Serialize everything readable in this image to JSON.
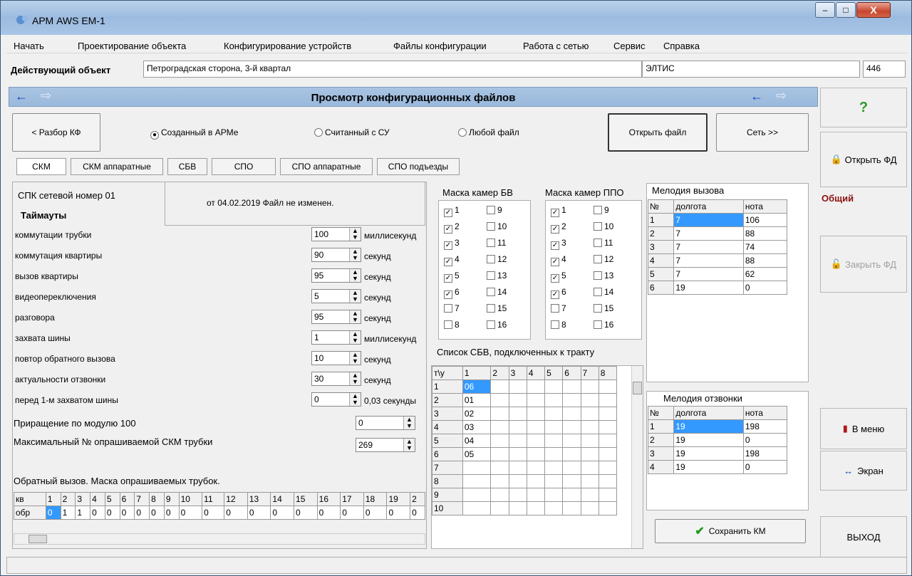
{
  "window": {
    "title": "АРМ AWS EM-1",
    "min": "–",
    "max": "□",
    "close": "X"
  },
  "menu": [
    "Начать",
    "Проектирование объекта",
    "Конфигурирование устройств",
    "Файлы конфигурации",
    "Работа с сетью",
    "Сервис",
    "Справка"
  ],
  "object": {
    "label": "Действующий объект",
    "name": "Петроградская сторона, 3-й квартал",
    "org": "ЭЛТИС",
    "code": "446"
  },
  "header": {
    "title": "Просмотр конфигурационных файлов",
    "back": "←",
    "fwd": "⇨"
  },
  "toolbar": {
    "parse": "< Разбор КФ",
    "radio": [
      "Созданный в АРМе",
      "Считанный с СУ",
      "Любой файл"
    ],
    "open": "Открыть файл",
    "net": "Сеть >>"
  },
  "tabs": [
    "СКМ",
    "СКМ аппаратные",
    "СБВ",
    "СПО",
    "СПО аппаратные",
    "СПО подъезды"
  ],
  "spk": {
    "label": "СПК сетевой номер  01",
    "date": "от 04.02.2019  Файл не изменен.",
    "timeouts": "Таймауты"
  },
  "timeouts": [
    {
      "name": "коммутации трубки",
      "value": "100",
      "unit": "миллисекунд"
    },
    {
      "name": "коммутация квартиры",
      "value": "90",
      "unit": "секунд"
    },
    {
      "name": "вызов квартиры",
      "value": "95",
      "unit": "секунд"
    },
    {
      "name": "видеопереключения",
      "value": "5",
      "unit": "секунд"
    },
    {
      "name": "разговора",
      "value": "95",
      "unit": "секунд"
    },
    {
      "name": "захвата шины",
      "value": "1",
      "unit": "миллисекунд"
    },
    {
      "name": "повтор обратного вызова",
      "value": "10",
      "unit": "секунд"
    },
    {
      "name": "актуальности отзвонки",
      "value": "30",
      "unit": "секунд"
    },
    {
      "name": "перед 1-м захватом шины",
      "value": "0",
      "unit": "0,03 секунды"
    }
  ],
  "increment": {
    "label": "Приращение по  модулю 100",
    "value": "0"
  },
  "maxskm": {
    "label": "Максимальный № опрашиваемой СКМ трубки",
    "value": "269"
  },
  "callback": {
    "label": "Обратный вызов. Маска опрашиваемых трубок.",
    "row1": "кв",
    "row2": "обр",
    "cols": [
      "1",
      "2",
      "3",
      "4",
      "5",
      "6",
      "7",
      "8",
      "9",
      "10",
      "11",
      "12",
      "13",
      "14",
      "15",
      "16",
      "17",
      "18",
      "19",
      "2"
    ],
    "vals": [
      "0",
      "1",
      "1",
      "0",
      "0",
      "0",
      "0",
      "0",
      "0",
      "0",
      "0",
      "0",
      "0",
      "0",
      "0",
      "0",
      "0",
      "0",
      "0",
      "0"
    ]
  },
  "maskBV": {
    "title": "Маска камер БВ",
    "items": [
      [
        "1",
        "9"
      ],
      [
        "2",
        "10"
      ],
      [
        "3",
        "11"
      ],
      [
        "4",
        "12"
      ],
      [
        "5",
        "13"
      ],
      [
        "6",
        "14"
      ],
      [
        "7",
        "15"
      ],
      [
        "8",
        "16"
      ]
    ],
    "checked": [
      1,
      1,
      1,
      1,
      1,
      1,
      0,
      0
    ]
  },
  "maskPPO": {
    "title": "Маска камер ППО",
    "items": [
      [
        "1",
        "9"
      ],
      [
        "2",
        "10"
      ],
      [
        "3",
        "11"
      ],
      [
        "4",
        "12"
      ],
      [
        "5",
        "13"
      ],
      [
        "6",
        "14"
      ],
      [
        "7",
        "15"
      ],
      [
        "8",
        "16"
      ]
    ],
    "checked": [
      1,
      1,
      1,
      1,
      1,
      1,
      0,
      0
    ]
  },
  "sbv": {
    "title": "Список СБВ, подключенных к тракту",
    "corner": "т\\у",
    "cols": [
      "1",
      "2",
      "3",
      "4",
      "5",
      "6",
      "7",
      "8"
    ],
    "rows": [
      "1",
      "2",
      "3",
      "4",
      "5",
      "6",
      "7",
      "8",
      "9",
      "10"
    ],
    "vals": [
      "06",
      "01",
      "02",
      "03",
      "04",
      "05",
      "",
      "",
      "",
      ""
    ]
  },
  "melodyCall": {
    "title": "Мелодия вызова",
    "h": [
      "№",
      "долгота",
      "нота"
    ],
    "rows": [
      [
        "1",
        "7",
        "106"
      ],
      [
        "2",
        "7",
        "88"
      ],
      [
        "3",
        "7",
        "74"
      ],
      [
        "4",
        "7",
        "88"
      ],
      [
        "5",
        "7",
        "62"
      ],
      [
        "6",
        "19",
        "0"
      ]
    ]
  },
  "melodyRing": {
    "title": "Мелодия отзвонки",
    "h": [
      "№",
      "долгота",
      "нота"
    ],
    "rows": [
      [
        "1",
        "19",
        "198"
      ],
      [
        "2",
        "19",
        "0"
      ],
      [
        "3",
        "19",
        "198"
      ],
      [
        "4",
        "19",
        "0"
      ]
    ]
  },
  "save": "Сохранить КМ",
  "side": {
    "help": "?",
    "open": "Открыть ФД",
    "general": "Общий",
    "close": "Закрыть ФД",
    "menu": "В меню",
    "screen": "Экран",
    "exit": "ВЫХОД"
  }
}
